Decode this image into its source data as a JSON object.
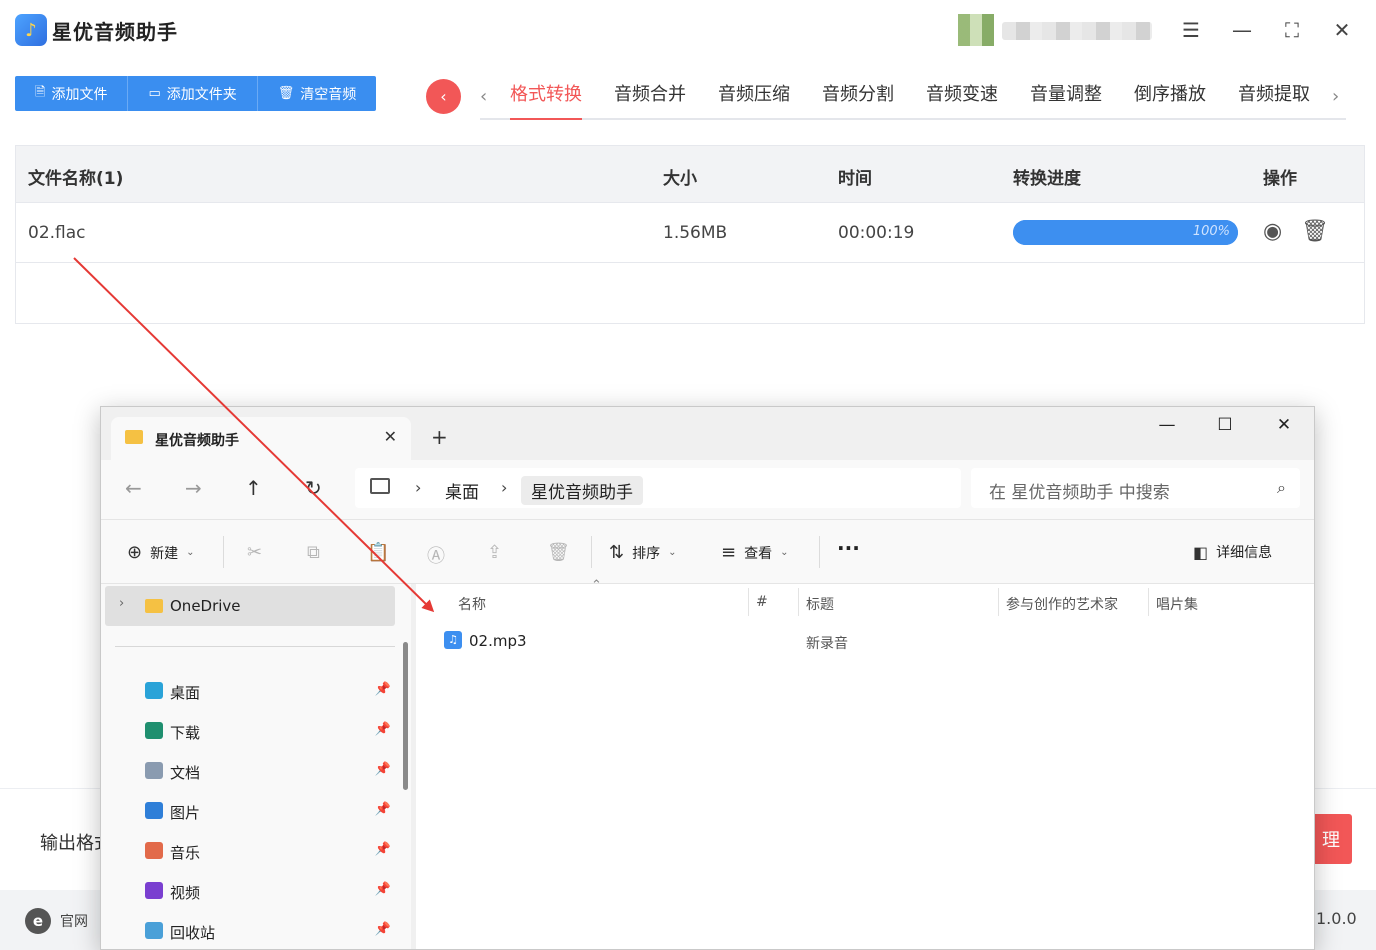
{
  "app": {
    "title": "星优音频助手",
    "logo_glyph": "♪",
    "toolbar": {
      "add_file": "添加文件",
      "add_folder": "添加文件夹",
      "clear": "清空音频"
    },
    "tabs": [
      "格式转换",
      "音频合并",
      "音频压缩",
      "音频分割",
      "音频变速",
      "音量调整",
      "倒序播放",
      "音频提取"
    ],
    "active_tab": "格式转换",
    "table": {
      "headers": {
        "name": "文件名称(1)",
        "size": "大小",
        "time": "时间",
        "progress": "转换进度",
        "ops": "操作"
      },
      "rows": [
        {
          "name": "02.flac",
          "size": "1.56MB",
          "time": "00:00:19",
          "progress": 100,
          "progress_label": "100%"
        }
      ]
    },
    "bottom": {
      "output_label": "输出格式",
      "start_label": "理"
    },
    "status": {
      "site_label": "官网",
      "version": "1.0.0"
    }
  },
  "explorer": {
    "tab_title": "星优音频助手",
    "breadcrumb": [
      "桌面",
      "星优音频助手"
    ],
    "search_placeholder": "在 星优音频助手 中搜索",
    "commands": {
      "new": "新建",
      "sort": "排序",
      "view": "查看",
      "more": "···",
      "details": "详细信息"
    },
    "nav": {
      "onedrive": "OneDrive",
      "items": [
        {
          "label": "桌面",
          "color": "#2aa3d8"
        },
        {
          "label": "下载",
          "color": "#1f8f6f"
        },
        {
          "label": "文档",
          "color": "#8a9bb0"
        },
        {
          "label": "图片",
          "color": "#2f7fd8"
        },
        {
          "label": "音乐",
          "color": "#e26a4a"
        },
        {
          "label": "视频",
          "color": "#7a3fd0"
        },
        {
          "label": "回收站",
          "color": "#4aa0d8"
        }
      ]
    },
    "columns": {
      "name": "名称",
      "number": "#",
      "title": "标题",
      "artist": "参与创作的艺术家",
      "album": "唱片集"
    },
    "files": [
      {
        "name": "02.mp3",
        "title": "新录音"
      }
    ]
  },
  "colors": {
    "accent_blue": "#3a8ef0",
    "accent_red": "#f25757",
    "arrow": "#e53935"
  }
}
